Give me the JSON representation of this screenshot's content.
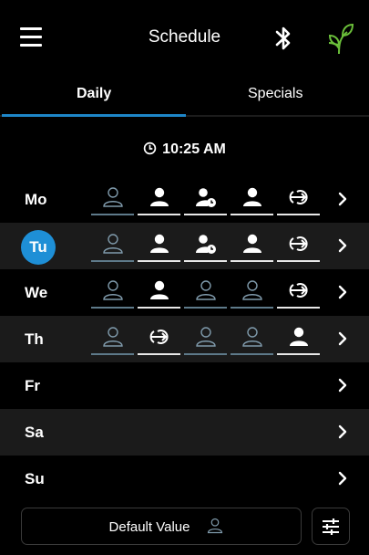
{
  "header": {
    "title": "Schedule"
  },
  "tabs": [
    {
      "label": "Daily",
      "active": true
    },
    {
      "label": "Specials",
      "active": false
    }
  ],
  "clock": {
    "time": "10:25 AM"
  },
  "accent_color": "#1e86c8",
  "today_badge_color": "#1e8fd6",
  "days": [
    {
      "label": "Mo",
      "today": false,
      "slots": [
        "person-outline",
        "person",
        "person-clock",
        "person",
        "arrow-in"
      ]
    },
    {
      "label": "Tu",
      "today": true,
      "slots": [
        "person-outline",
        "person",
        "person-clock",
        "person",
        "arrow-in"
      ]
    },
    {
      "label": "We",
      "today": false,
      "slots": [
        "person-outline",
        "person",
        "person-outline",
        "person-outline",
        "arrow-in"
      ]
    },
    {
      "label": "Th",
      "today": false,
      "slots": [
        "person-outline",
        "arrow-in",
        "person-outline",
        "person-outline",
        "person"
      ]
    },
    {
      "label": "Fr",
      "today": false,
      "slots": []
    },
    {
      "label": "Sa",
      "today": false,
      "slots": []
    },
    {
      "label": "Su",
      "today": false,
      "slots": []
    }
  ],
  "footer": {
    "default_label": "Default Value",
    "default_icon": "person-outline-icon",
    "filter_icon": "sliders-icon"
  }
}
